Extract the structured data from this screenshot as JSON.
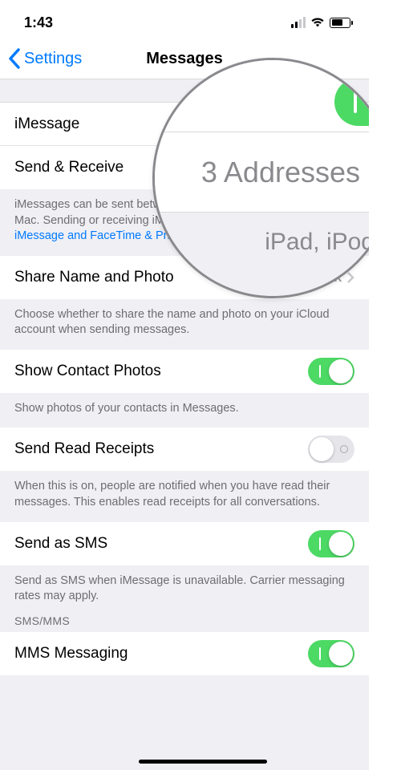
{
  "status": {
    "time": "1:43"
  },
  "nav": {
    "back": "Settings",
    "title": "Messages"
  },
  "rows": {
    "imessage": {
      "label": "iMessage"
    },
    "send_receive": {
      "label": "Send & Receive"
    },
    "share_name_photo": {
      "label": "Share Name and Photo",
      "value": "Always Ask"
    },
    "show_contact_photos": {
      "label": "Show Contact Photos"
    },
    "send_read_receipts": {
      "label": "Send Read Receipts"
    },
    "send_as_sms": {
      "label": "Send as SMS"
    },
    "mms_messaging": {
      "label": "MMS Messaging"
    }
  },
  "footers": {
    "imessage_footer_1": "iMessages can be sent between iPhone, iPad, iPod touch, and Mac. Sending or receiving iMessages uses wireless data.",
    "imessage_link": "About iMessage and FaceTime & Privacy",
    "share_footer": "Choose whether to share the name and photo on your iCloud account when sending messages.",
    "contact_photos_footer": "Show photos of your contacts in Messages.",
    "read_receipts_footer": "When this is on, people are notified when you have read their messages. This enables read receipts for all conversations.",
    "sms_footer": "Send as SMS when iMessage is unavailable. Carrier messaging rates may apply.",
    "sms_header": "SMS/MMS"
  },
  "magnifier": {
    "addresses_value": "3 Addresses",
    "footer_snip": "iPad, iPod"
  },
  "toggles": {
    "imessage": true,
    "show_contact_photos": true,
    "send_read_receipts": false,
    "send_as_sms": true,
    "mms_messaging": true
  },
  "colors": {
    "accent": "#007aff",
    "toggle_on": "#4cd964"
  }
}
